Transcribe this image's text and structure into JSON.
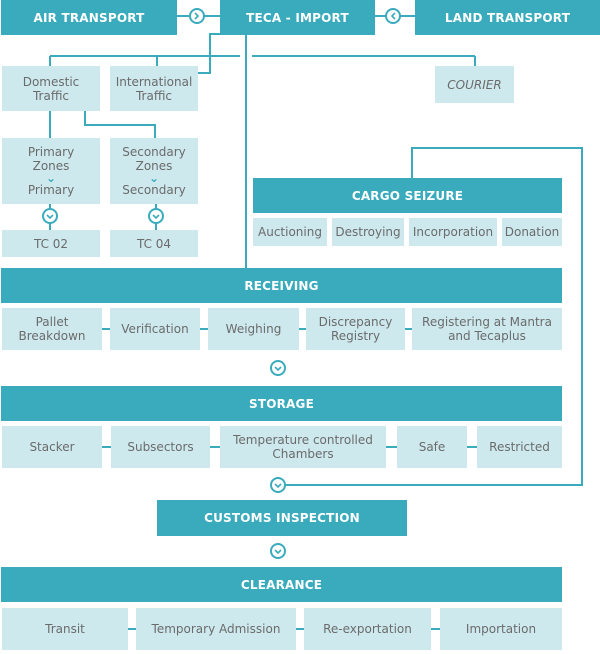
{
  "top": {
    "air": "AIR TRANSPORT",
    "teca": "TECA - IMPORT",
    "land": "LAND TRANSPORT"
  },
  "traffic": {
    "domestic": "Domestic Traffic",
    "international": "International Traffic",
    "courier": "COURIER"
  },
  "zones": {
    "primary_zones": "Primary Zones",
    "primary": "Primary",
    "secondary_zones": "Secondary Zones",
    "secondary": "Secondary",
    "tc02": "TC 02",
    "tc04": "TC 04"
  },
  "cargo_seizure": {
    "title": "CARGO SEIZURE",
    "items": [
      "Auctioning",
      "Destroying",
      "Incorporation",
      "Donation"
    ]
  },
  "receiving": {
    "title": "RECEIVING",
    "items": [
      "Pallet Breakdown",
      "Verification",
      "Weighing",
      "Discrepancy Registry",
      "Registering at Mantra and Tecaplus"
    ]
  },
  "storage": {
    "title": "STORAGE",
    "items": [
      "Stacker",
      "Subsectors",
      "Temperature controlled Chambers",
      "Safe",
      "Restricted"
    ]
  },
  "customs": {
    "title": "CUSTOMS INSPECTION"
  },
  "clearance": {
    "title": "CLEARANCE",
    "items": [
      "Transit",
      "Temporary Admission",
      "Re-exportation",
      "Importation"
    ]
  },
  "colors": {
    "accent": "#3aabbd",
    "box": "#cde9ee",
    "text": "#6b6b6b"
  }
}
